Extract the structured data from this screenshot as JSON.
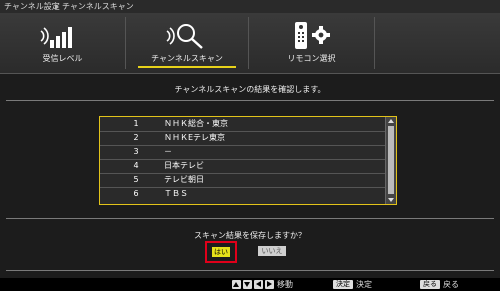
{
  "titlebar": {
    "crumb1": "チャンネル設定",
    "crumb2": "チャンネルスキャン"
  },
  "tabs": [
    {
      "label": "受信レベル",
      "icon": "signal-bars-icon"
    },
    {
      "label": "チャンネルスキャン",
      "icon": "channel-scan-icon",
      "selected": true
    },
    {
      "label": "リモコン選択",
      "icon": "remote-settings-icon"
    }
  ],
  "main": {
    "instruction": "チャンネルスキャンの結果を確認します。",
    "channels": [
      {
        "num": "1",
        "name": "ＮＨＫ総合・東京"
      },
      {
        "num": "2",
        "name": "ＮＨＫEテレ東京"
      },
      {
        "num": "3",
        "name": "－"
      },
      {
        "num": "4",
        "name": "日本テレビ"
      },
      {
        "num": "5",
        "name": "テレビ朝日"
      },
      {
        "num": "6",
        "name": "ＴＢＳ"
      }
    ],
    "question": "スキャン結果を保存しますか？",
    "yes_label": "はい",
    "no_label": "いいえ"
  },
  "footer": {
    "move": "移動",
    "decide_key": "決定",
    "decide": "決定",
    "back_key": "戻る",
    "back": "戻る"
  },
  "colors": {
    "accent": "#e2c31a",
    "highlight": "#e0001a",
    "yes_button": "#e6e21a"
  }
}
